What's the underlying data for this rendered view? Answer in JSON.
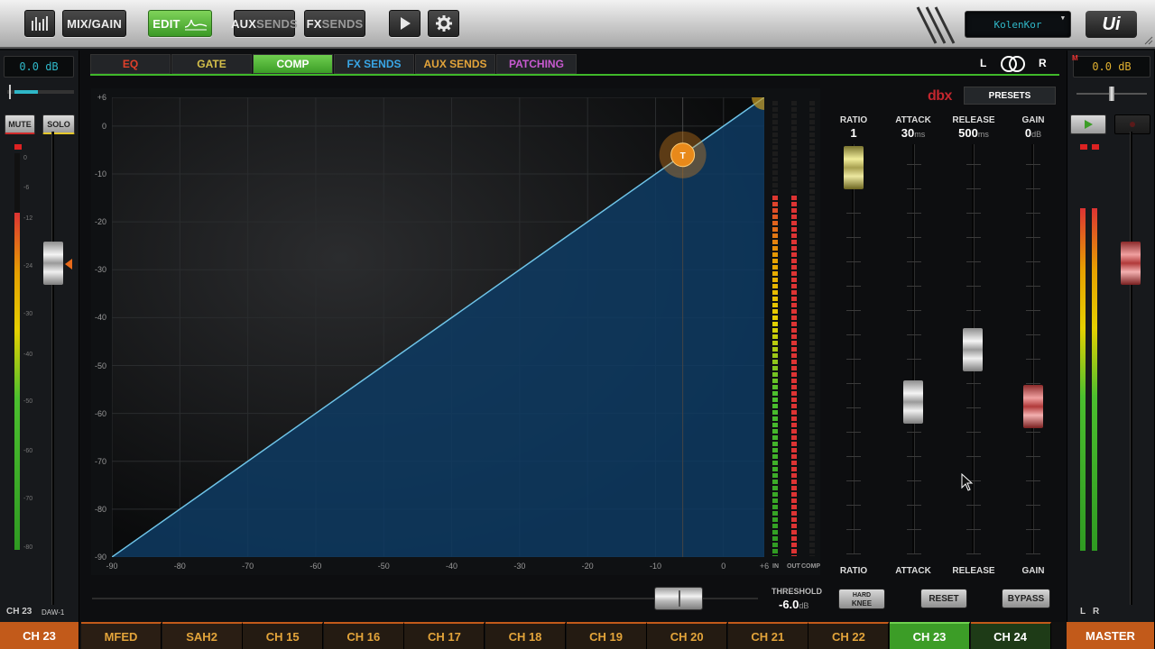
{
  "topbar": {
    "mixgain_label": "MIX/GAIN",
    "edit_label": "EDIT",
    "aux_sends": {
      "prefix": "AUX",
      "suffix": "SENDS"
    },
    "fx_sends": {
      "prefix": "FX",
      "suffix": "SENDS"
    },
    "screen_text": "KolenKor",
    "logo_text": "Ui"
  },
  "left_strip": {
    "db_value": "0.0 dB",
    "mute_label": "MUTE",
    "solo_label": "SOLO",
    "scale": [
      "0",
      "-6",
      "-12",
      "-24",
      "-30",
      "-40",
      "-50",
      "-60",
      "-70",
      "-80"
    ],
    "channel_label": "CH 23",
    "daw_label": "DAW-1"
  },
  "right_strip": {
    "db_value": "0.0 dB",
    "l_label": "L",
    "r_label": "R"
  },
  "tabs": [
    {
      "label": "EQ",
      "color": "#e0402a",
      "active": false
    },
    {
      "label": "GATE",
      "color": "#d5c04a",
      "active": false
    },
    {
      "label": "COMP",
      "color": "#ffffff",
      "active": true
    },
    {
      "label": "FX SENDS",
      "color": "#39a6e6",
      "active": false
    },
    {
      "label": "AUX SENDS",
      "color": "#e3a43a",
      "active": false
    },
    {
      "label": "PATCHING",
      "color": "#c85ad0",
      "active": false
    }
  ],
  "stereo": {
    "left": "L",
    "right": "R"
  },
  "brand": {
    "name": "dbx",
    "presets_label": "PRESETS"
  },
  "graph": {
    "y_ticks": [
      "+6",
      "0",
      "-10",
      "-20",
      "-30",
      "-40",
      "-50",
      "-60",
      "-70",
      "-80",
      "-90"
    ],
    "x_ticks": [
      "-90",
      "-80",
      "-70",
      "-60",
      "-50",
      "-40",
      "-30",
      "-20",
      "-10",
      "0",
      "+6"
    ],
    "threshold_marker": "T",
    "meter_labels": [
      "IN",
      "OUT",
      "COMP"
    ],
    "threshold_label": "THRESHOLD",
    "threshold_value": "-6.0",
    "threshold_unit": "dB",
    "threshold_db": -6
  },
  "controls": {
    "ratio": {
      "label": "RATIO",
      "value": "1",
      "unit": "",
      "footer": "RATIO"
    },
    "attack": {
      "label": "ATTACK",
      "value": "30",
      "unit": "ms",
      "footer": "ATTACK"
    },
    "release": {
      "label": "RELEASE",
      "value": "500",
      "unit": "ms",
      "footer": "RELEASE"
    },
    "gain": {
      "label": "GAIN",
      "value": "0",
      "unit": "dB",
      "footer": "GAIN"
    },
    "hard_knee": {
      "line1": "HARD",
      "line2": "KNEE"
    },
    "reset_label": "RESET",
    "bypass_label": "BYPASS"
  },
  "channels": [
    {
      "label": "CH 23",
      "color": "#ffffff",
      "bg": "#c25a1a"
    },
    {
      "label": "MFED",
      "color": "#e3a43a",
      "bg": "#2a1e14"
    },
    {
      "label": "SAH2",
      "color": "#e3a43a",
      "bg": "#2a1e14"
    },
    {
      "label": "CH 15",
      "color": "#e3a43a",
      "bg": "#241b12"
    },
    {
      "label": "CH 16",
      "color": "#e3a43a",
      "bg": "#241b12"
    },
    {
      "label": "CH 17",
      "color": "#e3a43a",
      "bg": "#241b12"
    },
    {
      "label": "CH 18",
      "color": "#e3a43a",
      "bg": "#241b12"
    },
    {
      "label": "CH 19",
      "color": "#e3a43a",
      "bg": "#241b12"
    },
    {
      "label": "CH 20",
      "color": "#e3a43a",
      "bg": "#241b12"
    },
    {
      "label": "CH 21",
      "color": "#e3a43a",
      "bg": "#241b12"
    },
    {
      "label": "CH 22",
      "color": "#e3a43a",
      "bg": "#241b12"
    },
    {
      "label": "CH 23",
      "color": "#ffffff",
      "bg": "#3c9d27"
    },
    {
      "label": "CH 24",
      "color": "#ffffff",
      "bg": "#1e3b17"
    },
    {
      "label": "MASTER",
      "color": "#ffffff",
      "bg": "#c25a1a"
    }
  ]
}
